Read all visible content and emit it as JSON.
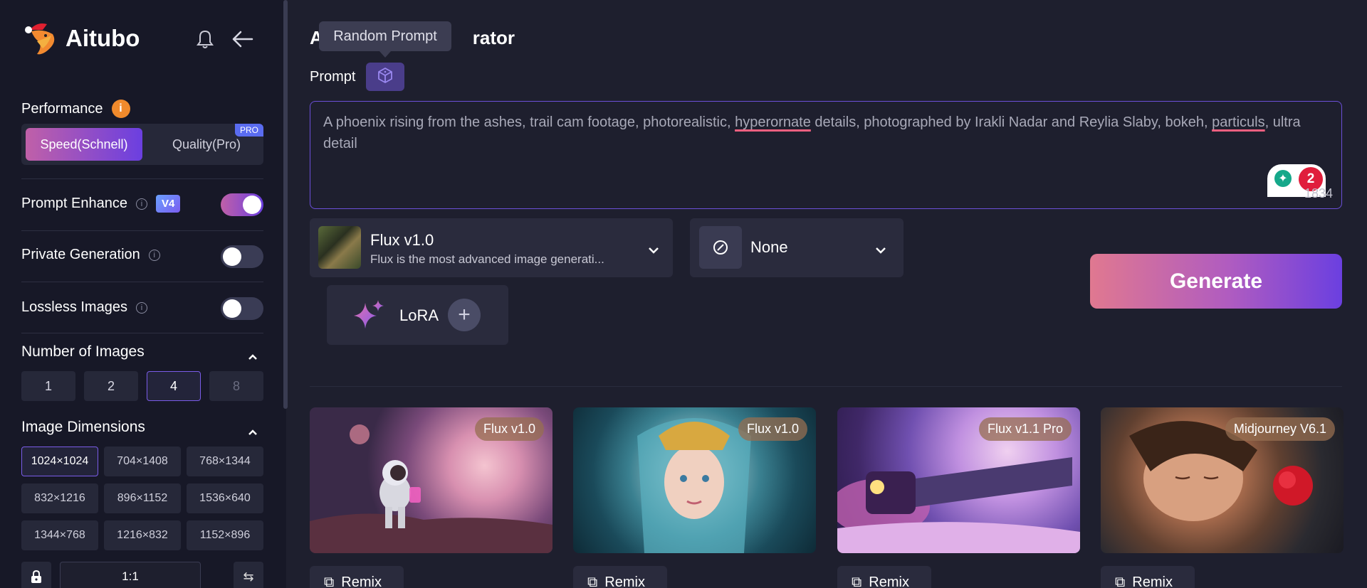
{
  "app": {
    "name": "Aitubo"
  },
  "sidebar": {
    "performance": {
      "label": "Performance",
      "info": "i",
      "options": [
        "Speed(Schnell)",
        "Quality(Pro)"
      ],
      "selected": "Speed(Schnell)",
      "pro_badge": "PRO"
    },
    "prompt_enhance": {
      "label": "Prompt Enhance",
      "badge": "V4",
      "enabled": true
    },
    "private_generation": {
      "label": "Private Generation",
      "enabled": false
    },
    "lossless_images": {
      "label": "Lossless Images",
      "enabled": false
    },
    "number_of_images": {
      "label": "Number of Images",
      "options": [
        "1",
        "2",
        "4",
        "8"
      ],
      "selected": "4",
      "disabled": [
        "8"
      ]
    },
    "image_dimensions": {
      "label": "Image Dimensions",
      "options": [
        "1024×1024",
        "704×1408",
        "768×1344",
        "832×1216",
        "896×1152",
        "1536×640",
        "1344×768",
        "1216×832",
        "1152×896"
      ],
      "selected": "1024×1024"
    },
    "aspect_ratio": "1:1",
    "swap_symbol": "⇆"
  },
  "main": {
    "title": "AI Image Generator",
    "title_visible": "A",
    "title_visible_tail": "rator",
    "tooltip": "Random Prompt",
    "prompt_label": "Prompt",
    "prompt": {
      "part1": "A phoenix rising from the ashes, trail cam footage, photorealistic, ",
      "err1": "hyperornate",
      "part2": " details, photographed by Irakli Nadar and Reylia Slaby, bokeh, ",
      "err2": "particuls",
      "part3": ", ultra detail"
    },
    "char_count": "1834",
    "extension": {
      "notifications": "2"
    },
    "model": {
      "name": "Flux v1.0",
      "description": "Flux is the most advanced image generati..."
    },
    "style": {
      "name": "None"
    },
    "lora": {
      "label": "LoRA",
      "add": "+"
    },
    "generate_label": "Generate",
    "gallery": [
      {
        "badge": "Flux v1.0",
        "remix": "Remix"
      },
      {
        "badge": "Flux v1.0",
        "remix": "Remix"
      },
      {
        "badge": "Flux v1.1 Pro",
        "remix": "Remix"
      },
      {
        "badge": "Midjourney V6.1",
        "remix": "Remix"
      }
    ]
  },
  "colors": {
    "accent_purple": "#6b3fe0",
    "accent_pink": "#c060a8",
    "info_orange": "#f08a2c",
    "background": "#1e1f2e",
    "sidebar": "#171827"
  }
}
